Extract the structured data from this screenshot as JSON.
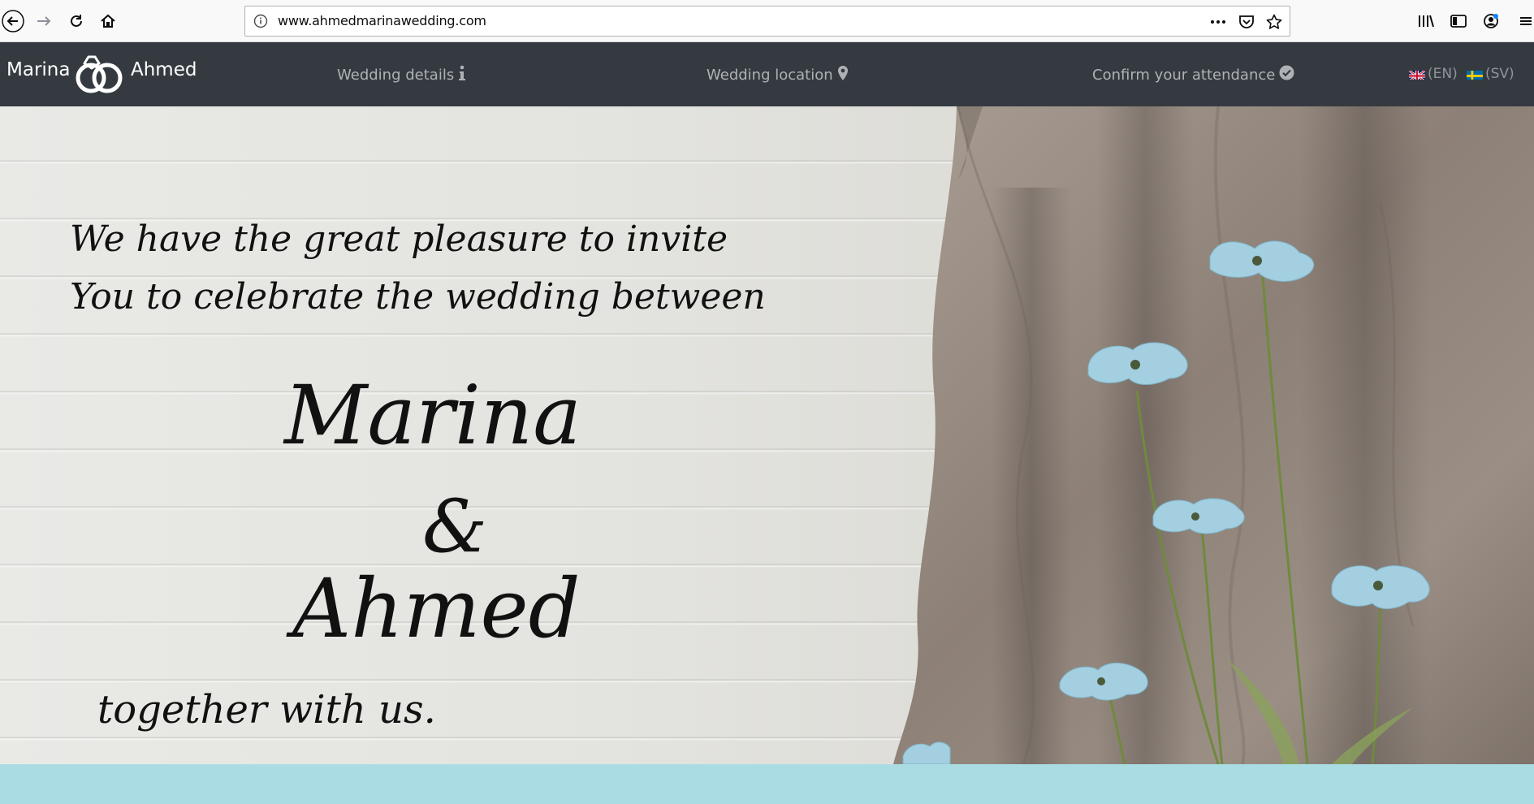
{
  "browser": {
    "url": "www.ahmedmarinawedding.com",
    "icons": [
      "back-icon",
      "forward-icon",
      "reload-icon",
      "home-icon",
      "site-info-icon",
      "page-actions-icon",
      "pocket-icon",
      "bookmark-star-icon",
      "library-icon",
      "sidebar-icon",
      "account-icon",
      "menu-icon"
    ]
  },
  "nav": {
    "brand_left": "Marina",
    "brand_right": "Ahmed",
    "links": [
      {
        "label": "Wedding details",
        "icon": "info-icon"
      },
      {
        "label": "Wedding location",
        "icon": "map-marker-icon"
      },
      {
        "label": "Confirm your attendance",
        "icon": "check-circle-icon"
      }
    ],
    "languages": [
      {
        "label": "(EN)",
        "icon": "uk-flag-icon"
      },
      {
        "label": "(SV)",
        "icon": "sweden-flag-icon"
      }
    ],
    "background": "#343a40"
  },
  "hero": {
    "line1": "We have the great pleasure to invite",
    "line2": "You to celebrate the wedding between",
    "name1": "Marina",
    "ampersand": "&",
    "name2": "Ahmed",
    "closing": "together with us."
  },
  "colors": {
    "footer_band": "#a9dde3",
    "flower_blue": "#a3cfe0"
  }
}
